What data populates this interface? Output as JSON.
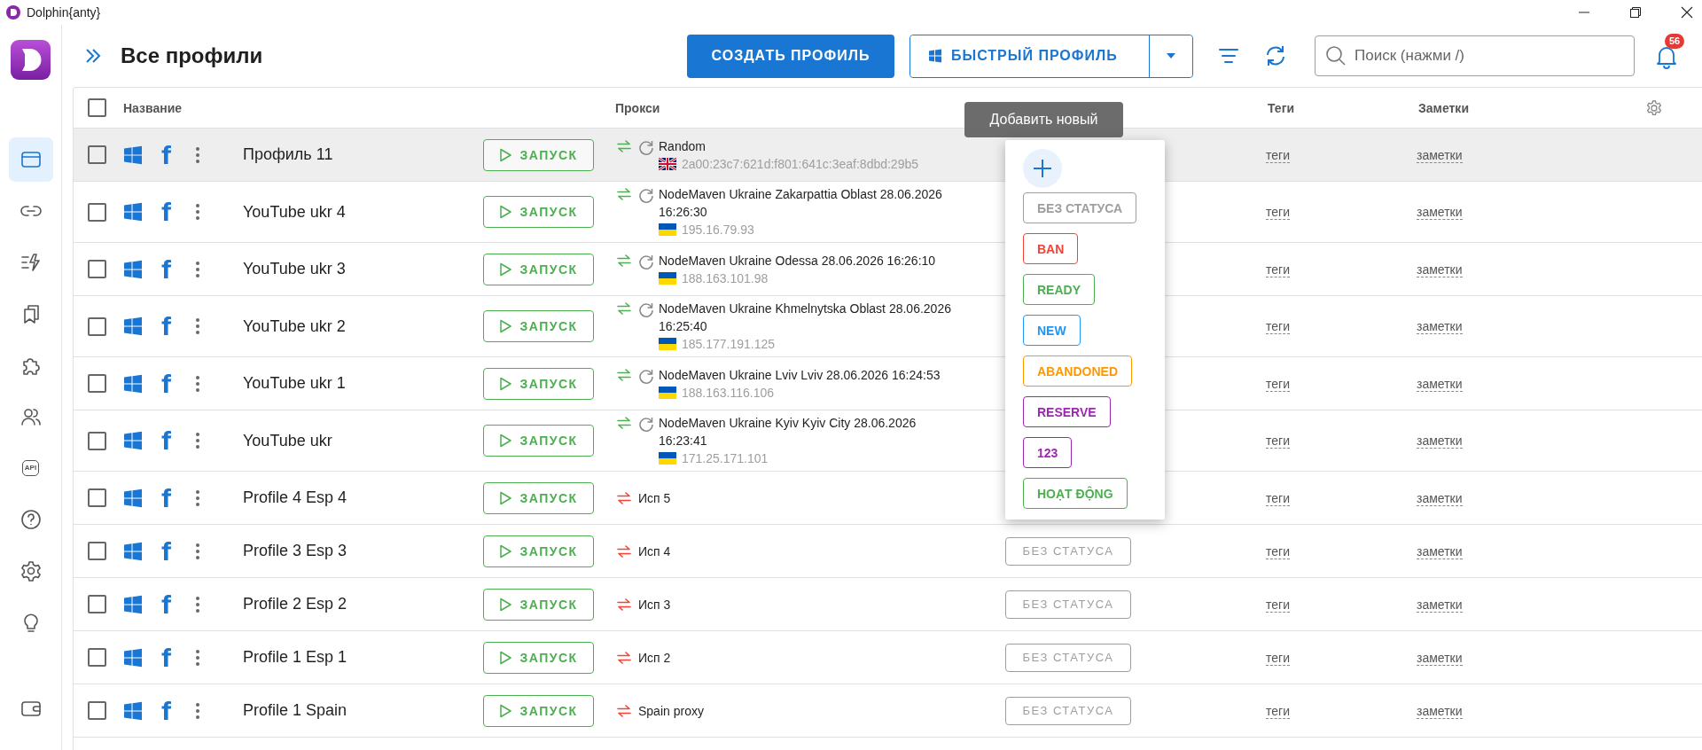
{
  "window": {
    "title": "Dolphin{anty}"
  },
  "sidebar": {
    "items": [
      {
        "selected": true
      },
      {
        "selected": false
      },
      {
        "selected": false
      },
      {
        "selected": false
      },
      {
        "selected": false
      },
      {
        "selected": false
      },
      {
        "selected": false,
        "label": "API"
      },
      {
        "selected": false
      },
      {
        "selected": false
      },
      {
        "selected": false
      }
    ],
    "bottom_item": {
      "selected": false
    }
  },
  "header": {
    "title": "Все профили",
    "create_button": "СОЗДАТЬ ПРОФИЛЬ",
    "quick_button": "БЫСТРЫЙ ПРОФИЛЬ",
    "search": {
      "placeholder": "Поиск (нажми /)"
    },
    "notifications": "56"
  },
  "table": {
    "columns": [
      "Название",
      "Прокси",
      "Теги",
      "Заметки"
    ],
    "all_checked": false,
    "rows": [
      {
        "name": "Профиль 11",
        "checked": false,
        "selected": true,
        "launch": "ЗАПУСК",
        "proxy": {
          "kind": "rotating",
          "name": "Random",
          "ip": "2a00:23c7:621d:f801:641c:3eaf:8dbd:29b5",
          "flag": {
            "kind": "gb"
          }
        },
        "tags": "теги",
        "notes": "заметки"
      },
      {
        "name": "YouTube ukr 4",
        "checked": false,
        "selected": false,
        "launch": "ЗАПУСК",
        "proxy": {
          "kind": "rotating",
          "name": "NodeMaven Ukraine Zakarpattia Oblast 28.06.2026 16:26:30",
          "ip": "195.16.79.93",
          "flag": {
            "kind": "ua"
          }
        },
        "tags": "теги",
        "notes": "заметки"
      },
      {
        "name": "YouTube ukr 3",
        "checked": false,
        "selected": false,
        "launch": "ЗАПУСК",
        "proxy": {
          "kind": "rotating",
          "name": "NodeMaven Ukraine Odessa 28.06.2026 16:26:10",
          "ip": "188.163.101.98",
          "flag": {
            "kind": "ua"
          }
        },
        "tags": "теги",
        "notes": "заметки"
      },
      {
        "name": "YouTube ukr 2",
        "checked": false,
        "selected": false,
        "launch": "ЗАПУСК",
        "proxy": {
          "kind": "rotating",
          "name": "NodeMaven Ukraine Khmelnytska Oblast 28.06.2026 16:25:40",
          "ip": "185.177.191.125",
          "flag": {
            "kind": "ua"
          }
        },
        "tags": "теги",
        "notes": "заметки"
      },
      {
        "name": "YouTube ukr 1",
        "checked": false,
        "selected": false,
        "launch": "ЗАПУСК",
        "proxy": {
          "kind": "rotating",
          "name": "NodeMaven Ukraine Lviv Lviv 28.06.2026 16:24:53",
          "ip": "188.163.116.106",
          "flag": {
            "kind": "ua"
          }
        },
        "tags": "теги",
        "notes": "заметки"
      },
      {
        "name": "YouTube ukr",
        "checked": false,
        "selected": false,
        "launch": "ЗАПУСК",
        "proxy": {
          "kind": "rotating",
          "name": "NodeMaven Ukraine Kyiv Kyiv City 28.06.2026 16:23:41",
          "ip": "171.25.171.101",
          "flag": {
            "kind": "ua"
          }
        },
        "tags": "теги",
        "notes": "заметки"
      },
      {
        "name": "Profile 4 Esp 4",
        "checked": false,
        "selected": false,
        "launch": "ЗАПУСК",
        "proxy": {
          "kind": "static",
          "name": "Исп 5"
        },
        "tags": "теги",
        "notes": "заметки"
      },
      {
        "name": "Profile 3 Esp 3",
        "checked": false,
        "selected": false,
        "launch": "ЗАПУСК",
        "proxy": {
          "kind": "static",
          "name": "Исп 4"
        },
        "status": {
          "label": "БЕЗ СТАТУСА",
          "color": "#9e9e9e"
        },
        "tags": "теги",
        "notes": "заметки"
      },
      {
        "name": "Profile 2 Esp 2",
        "checked": false,
        "selected": false,
        "launch": "ЗАПУСК",
        "proxy": {
          "kind": "static",
          "name": "Исп 3"
        },
        "status": {
          "label": "БЕЗ СТАТУСА",
          "color": "#9e9e9e"
        },
        "tags": "теги",
        "notes": "заметки"
      },
      {
        "name": "Profile 1 Esp 1",
        "checked": false,
        "selected": false,
        "launch": "ЗАПУСК",
        "proxy": {
          "kind": "static",
          "name": "Исп 2"
        },
        "status": {
          "label": "БЕЗ СТАТУСА",
          "color": "#9e9e9e"
        },
        "tags": "теги",
        "notes": "заметки"
      },
      {
        "name": "Profile 1 Spain",
        "checked": false,
        "selected": false,
        "launch": "ЗАПУСК",
        "proxy": {
          "kind": "static",
          "name": "Spain proxy"
        },
        "status": {
          "label": "БЕЗ СТАТУСА",
          "color": "#9e9e9e"
        },
        "tags": "теги",
        "notes": "заметки"
      }
    ]
  },
  "tooltip": "Добавить новый",
  "status_menu": {
    "options": [
      {
        "label": "БЕЗ СТАТУСА",
        "color": "#9e9e9e"
      },
      {
        "label": "BAN",
        "color": "#f44336"
      },
      {
        "label": "READY",
        "color": "#4caf50"
      },
      {
        "label": "NEW",
        "color": "#2196f3"
      },
      {
        "label": "ABANDONED",
        "color": "#ff9800"
      },
      {
        "label": "RESERVE",
        "color": "#9c27b0"
      },
      {
        "label": "123",
        "color": "#9c27b0"
      },
      {
        "label": "HOẠT ĐỘNG",
        "color": "#4caf50"
      }
    ]
  }
}
